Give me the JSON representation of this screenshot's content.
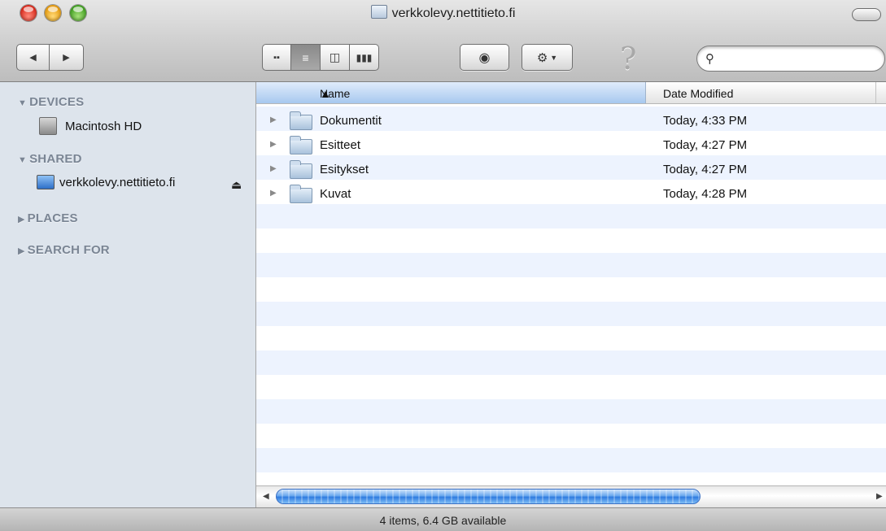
{
  "window": {
    "title": "verkkolevy.nettitieto.fi"
  },
  "toolbar": {
    "back_icon": "arrow-left-icon",
    "forward_icon": "arrow-right-icon",
    "views": [
      "icon-view",
      "list-view",
      "column-view",
      "cover-flow-view"
    ],
    "active_view": "list-view",
    "quicklook_icon": "eye-icon",
    "action_icon": "gear-icon",
    "help_label": "?",
    "search_value": ""
  },
  "sidebar": {
    "sections": [
      {
        "label": "DEVICES",
        "expanded": true,
        "items": [
          {
            "label": "Macintosh HD",
            "icon": "hard-drive-icon"
          }
        ]
      },
      {
        "label": "SHARED",
        "expanded": true,
        "items": [
          {
            "label": "verkkolevy.nettitieto.fi",
            "icon": "network-monitor-icon",
            "eject": true
          }
        ]
      },
      {
        "label": "PLACES",
        "expanded": false,
        "items": []
      },
      {
        "label": "SEARCH FOR",
        "expanded": false,
        "items": []
      }
    ]
  },
  "list": {
    "columns": [
      "Name",
      "Date Modified"
    ],
    "sort_column": "Name",
    "sort_direction": "ascending",
    "rows": [
      {
        "name": "Dokumentit",
        "date": "Today, 4:33 PM"
      },
      {
        "name": "Esitteet",
        "date": "Today, 4:27 PM"
      },
      {
        "name": "Esitykset",
        "date": "Today, 4:27 PM"
      },
      {
        "name": "Kuvat",
        "date": "Today, 4:28 PM"
      }
    ]
  },
  "status": {
    "text": "4 items, 6.4 GB available"
  },
  "colors": {
    "sidebar_bg": "#dde4ec",
    "row_stripe": "#edf3fe",
    "header_selected": "#a7c8ef"
  }
}
